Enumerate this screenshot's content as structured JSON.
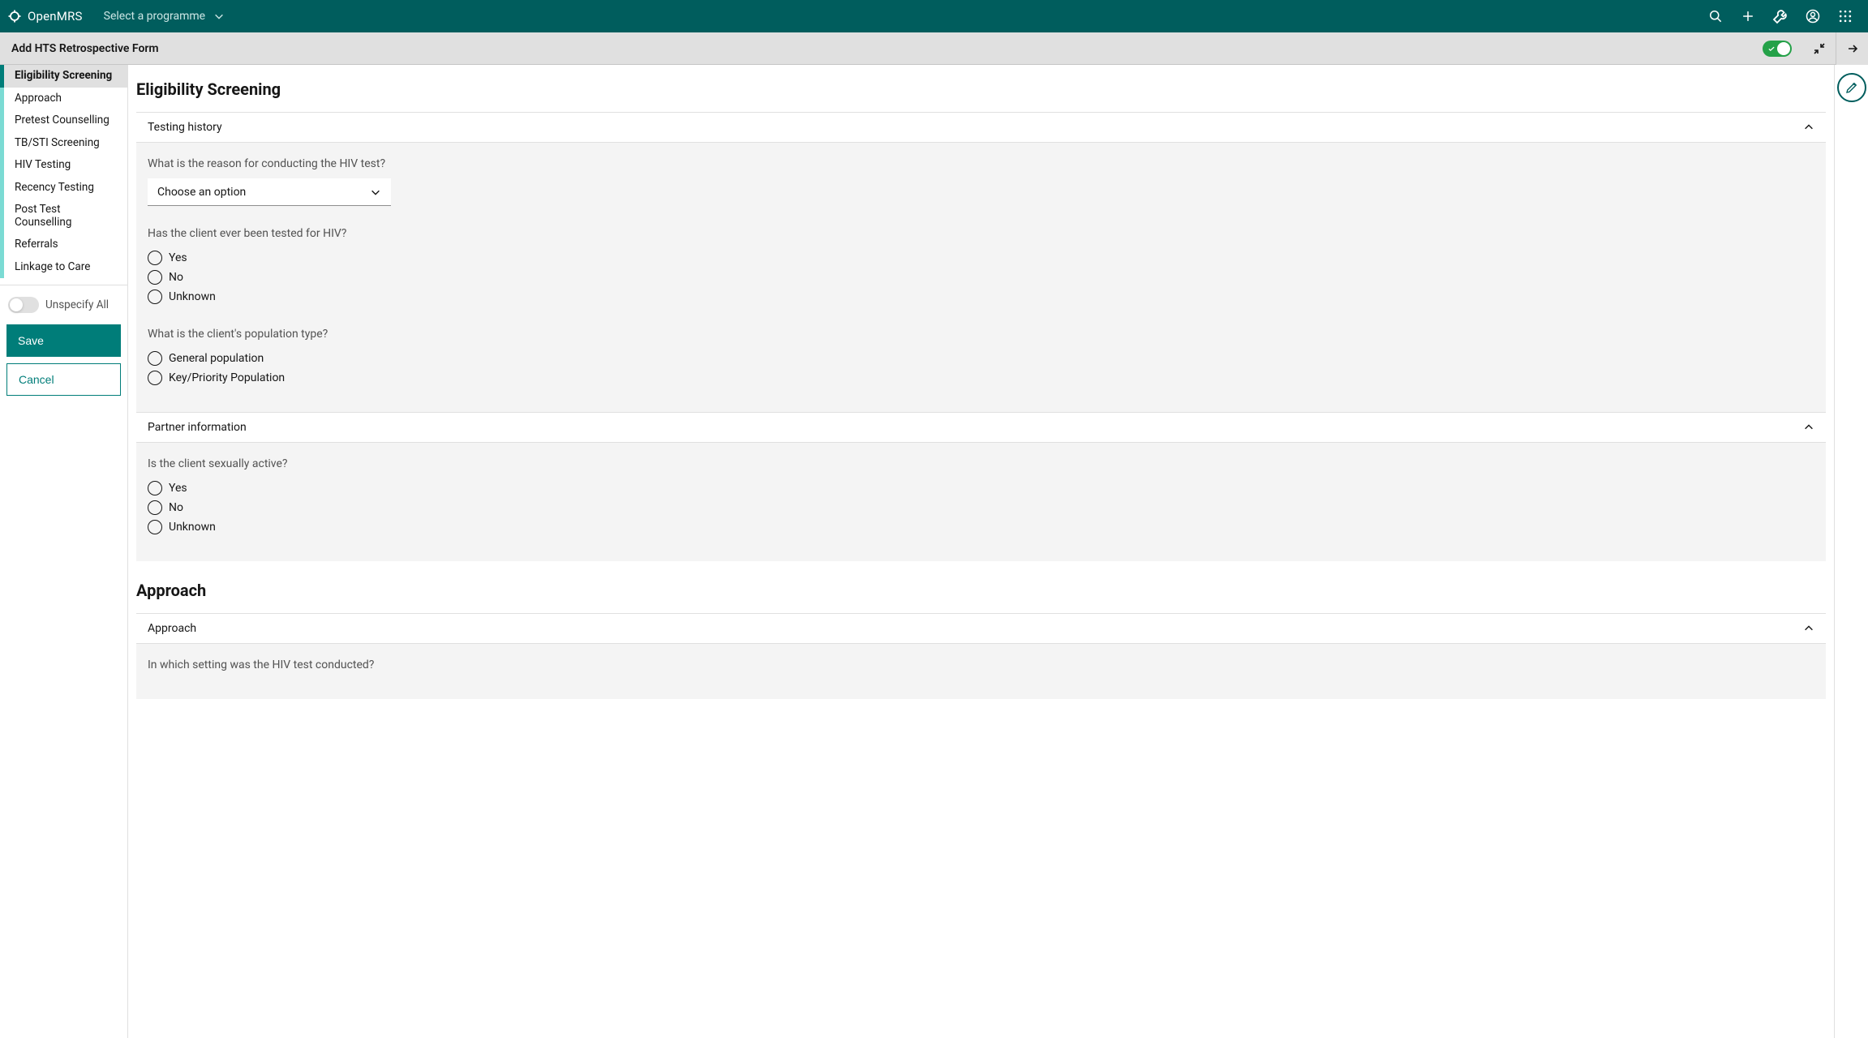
{
  "brand": {
    "name": "OpenMRS"
  },
  "programme_selector": {
    "label": "Select a programme"
  },
  "subheader": {
    "title": "Add HTS Retrospective Form"
  },
  "sidebar": {
    "items": [
      {
        "label": "Eligibility Screening",
        "active": true
      },
      {
        "label": "Approach"
      },
      {
        "label": "Pretest Counselling"
      },
      {
        "label": "TB/STI Screening"
      },
      {
        "label": "HIV Testing"
      },
      {
        "label": "Recency Testing"
      },
      {
        "label": "Post Test Counselling"
      },
      {
        "label": "Referrals"
      },
      {
        "label": "Linkage to Care"
      }
    ],
    "unspecify_label": "Unspecify All",
    "save_label": "Save",
    "cancel_label": "Cancel"
  },
  "page": {
    "heading": "Eligibility Screening",
    "sections": {
      "testing_history": {
        "title": "Testing history",
        "q_reason": "What is the reason for conducting the HIV test?",
        "reason_placeholder": "Choose an option",
        "q_tested": "Has the client ever been tested for HIV?",
        "opt_yes": "Yes",
        "opt_no": "No",
        "opt_unknown": "Unknown",
        "q_population": "What is the client's population type?",
        "opt_general": "General population",
        "opt_keypop": "Key/Priority Population"
      },
      "partner_info": {
        "title": "Partner information",
        "q_active": "Is the client sexually active?",
        "opt_yes": "Yes",
        "opt_no": "No",
        "opt_unknown": "Unknown"
      }
    },
    "approach": {
      "heading": "Approach",
      "section_title": "Approach",
      "q_setting": "In which setting was the HIV test conducted?"
    }
  },
  "colors": {
    "primary": "#005d5d",
    "teal": "#007d79",
    "success": "#24a148"
  }
}
